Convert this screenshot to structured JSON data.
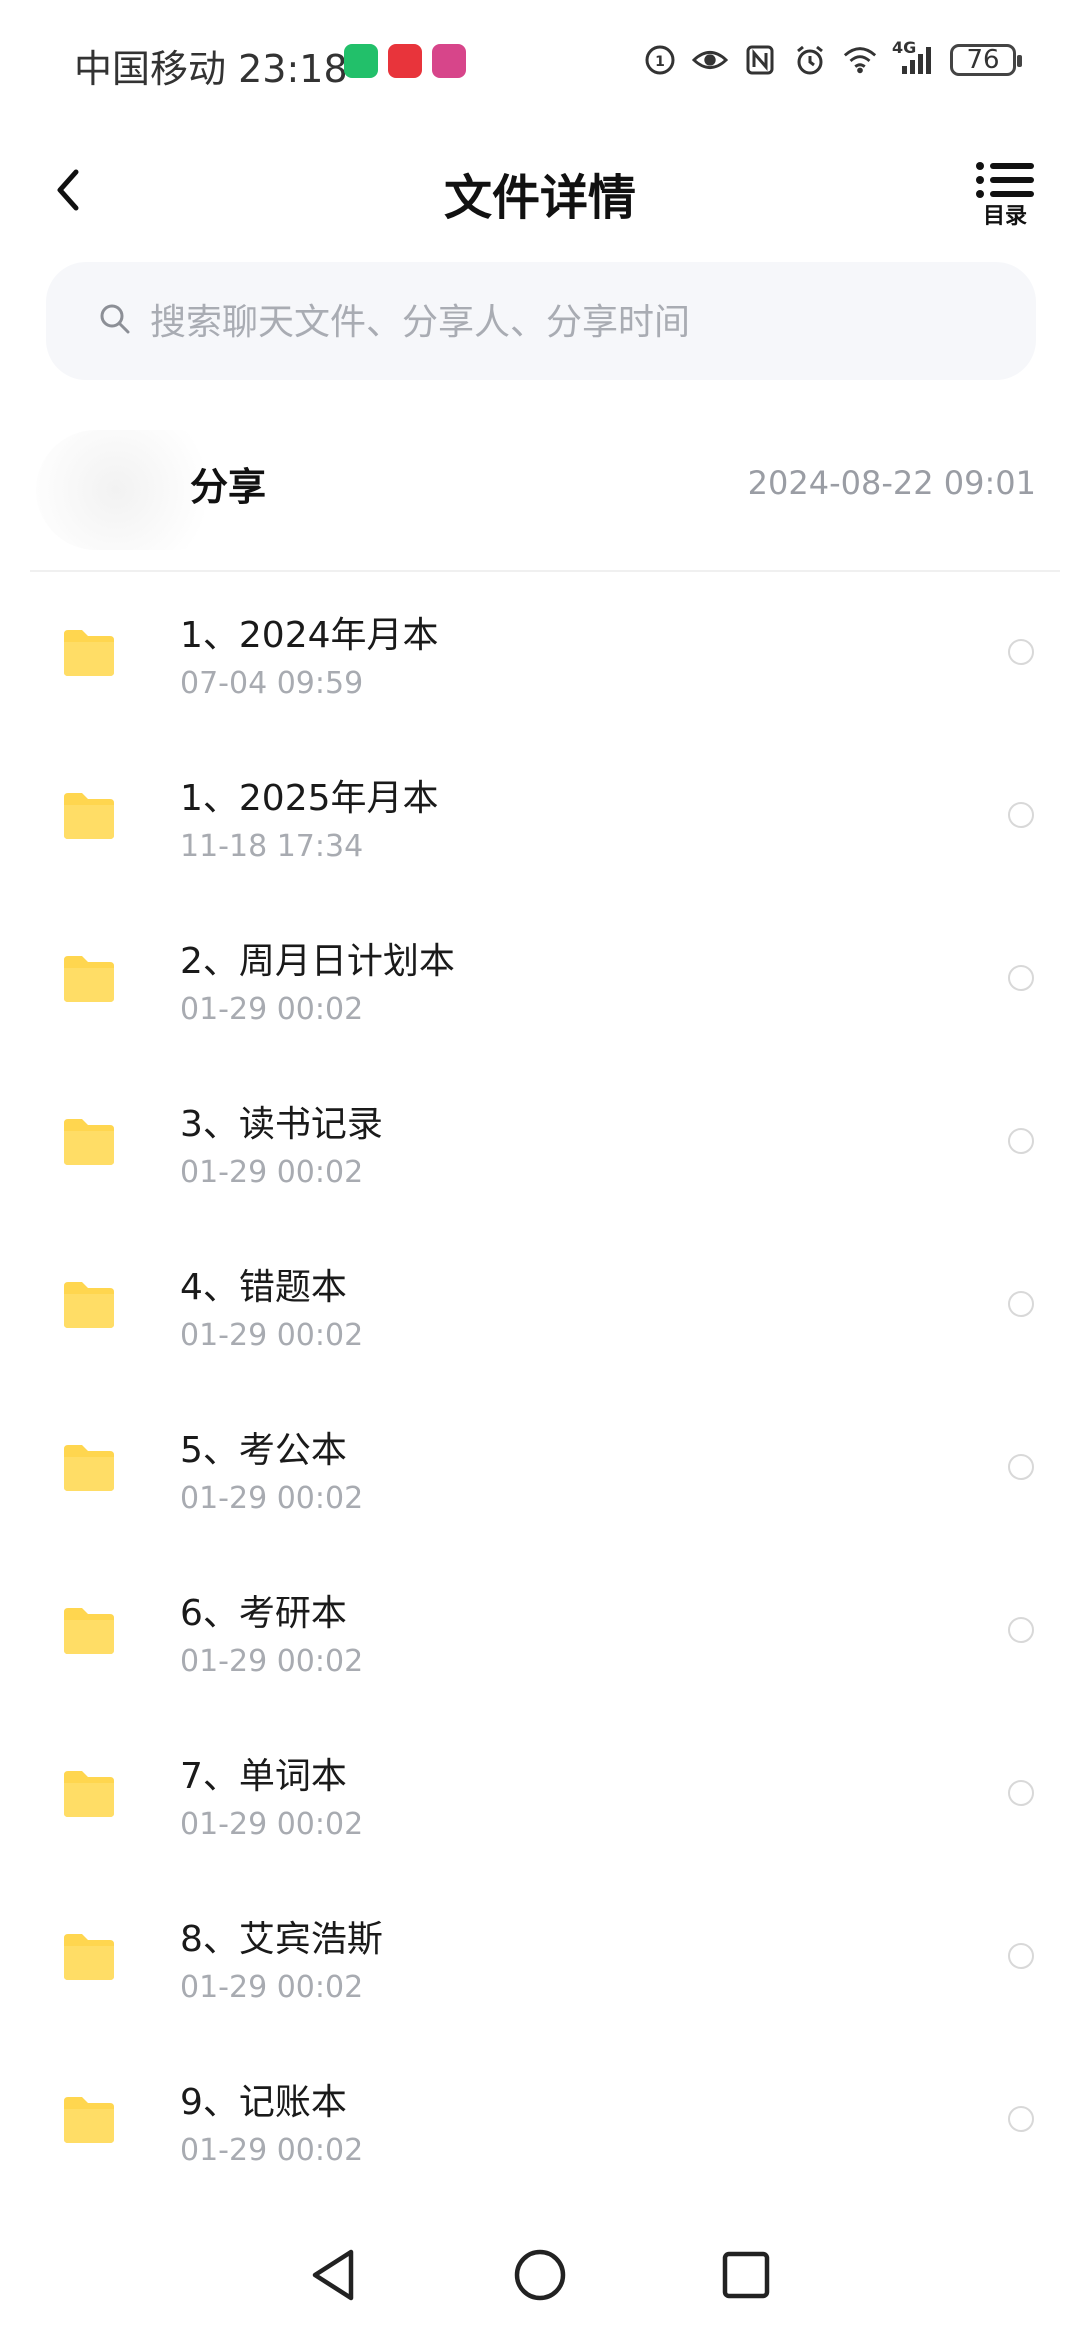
{
  "status_bar": {
    "carrier": "中国移动",
    "time": "23:18",
    "network": "4G",
    "battery": "76"
  },
  "header": {
    "title": "文件详情",
    "toc_label": "目录"
  },
  "search": {
    "placeholder": "搜索聊天文件、分享人、分享时间"
  },
  "sharer": {
    "name": "分享",
    "date": "2024-08-22  09:01"
  },
  "files": [
    {
      "name": "1、2024年月本",
      "time": "07-04  09:59"
    },
    {
      "name": "1、2025年月本",
      "time": "11-18  17:34"
    },
    {
      "name": "2、周月日计划本",
      "time": "01-29  00:02"
    },
    {
      "name": "3、读书记录",
      "time": "01-29  00:02"
    },
    {
      "name": "4、错题本",
      "time": "01-29  00:02"
    },
    {
      "name": "5、考公本",
      "time": "01-29  00:02"
    },
    {
      "name": "6、考研本",
      "time": "01-29  00:02"
    },
    {
      "name": "7、单词本",
      "time": "01-29  00:02"
    },
    {
      "name": "8、艾宾浩斯",
      "time": "01-29  00:02"
    },
    {
      "name": "9、记账本",
      "time": "01-29  00:02"
    }
  ],
  "colors": {
    "folder": "#FFD64F",
    "muted": "#A8ABB1",
    "search_bg": "#F6F7FA"
  }
}
